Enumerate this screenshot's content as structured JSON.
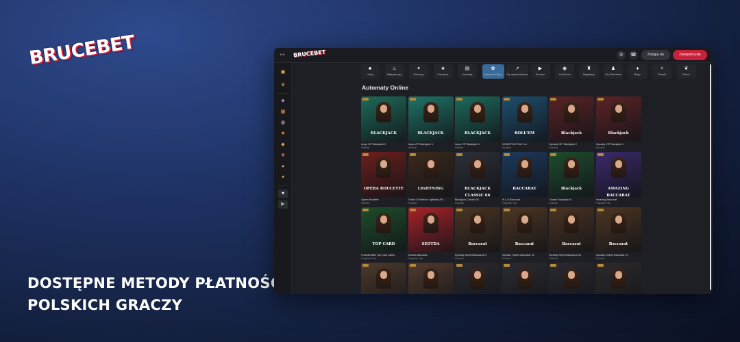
{
  "brand": {
    "logo_text": "BRUCEBET",
    "accent_red": "#c8213b",
    "accent_blue": "#1b2a6b"
  },
  "headline": {
    "line1": "DOSTĘPNE METODY PŁATNOŚCI DLA",
    "line2": "POLSKICH GRACZY"
  },
  "app": {
    "topbar": {
      "collapse_icon": "↦",
      "mini_logo": "BRUCEBET",
      "icons": [
        "settings-icon",
        "support-icon"
      ],
      "login_label": "Zaloguj się",
      "register_label": "Zarejestruj się"
    },
    "sidebar_icons": [
      "gift-icon",
      "trophy-icon",
      "dice-icon",
      "cards-icon",
      "ball-icon",
      "star-icon",
      "chip-icon",
      "game-icon",
      "coin-icon",
      "apple-icon",
      "android-icon"
    ],
    "categories": [
      {
        "icon": "♣",
        "label": "Lobby"
      },
      {
        "icon": "♨",
        "label": "Najlepsze gry"
      },
      {
        "icon": "✦",
        "label": "Nowe gry"
      },
      {
        "icon": "★",
        "label": "Popularne"
      },
      {
        "icon": "▤",
        "label": "Automaty"
      },
      {
        "icon": "✿",
        "label": "Kasyno Na Żywo"
      },
      {
        "icon": "➚",
        "label": "Gry natychmiastowe"
      },
      {
        "icon": "▶",
        "label": "Na żywo"
      },
      {
        "icon": "◉",
        "label": "Kup Bonus"
      },
      {
        "icon": "♜",
        "label": "Megaways"
      },
      {
        "icon": "♟",
        "label": "Gry Planszowe"
      },
      {
        "icon": "♦",
        "label": "Bingo"
      },
      {
        "icon": "✧",
        "label": "Zdrapki"
      },
      {
        "icon": "❦",
        "label": "Owoce"
      }
    ],
    "section_title": "Automaty Online",
    "games": [
      {
        "banner": "BLACKJACK",
        "name": "Aqua VIP Blackjack 2",
        "provider": "Winfinity",
        "bg": "#1d6b5a"
      },
      {
        "banner": "BLACKJACK",
        "name": "Aqua VIP Blackjack 3",
        "provider": "Winfinity",
        "bg": "#1f7466"
      },
      {
        "banner": "BLACKJACK",
        "name": "Aqua VIP Blackjack 1",
        "provider": "Winfinity",
        "bg": "#1b6a5c"
      },
      {
        "banner": "ROLL'EM",
        "name": "MONOPOLY Roll 'em",
        "provider": "Evolution",
        "bg": "#1e4f6e"
      },
      {
        "banner": "Blackjack",
        "name": "Dynasty VIP Blackjack 2",
        "provider": "Evolution",
        "bg": "#5a2325"
      },
      {
        "banner": "Blackjack",
        "name": "Dynasty VIP Blackjack 1",
        "provider": "Evolution",
        "bg": "#5c2426"
      },
      {
        "banner": "OPERA ROULETTE",
        "name": "Opera Roulette",
        "provider": "Winfinity",
        "bg": "#6b1f1c"
      },
      {
        "banner": "LIGHTNING",
        "name": "Turbot XXXtreme Lightning Ro...",
        "provider": "Evolution",
        "bg": "#3a2a1c"
      },
      {
        "banner": "BLACKJACK CLASSIC 66",
        "name": "Blackjack Classic 66",
        "provider": "Evolution",
        "bg": "#2c3038"
      },
      {
        "banner": "BACCARAT",
        "name": "HI-LO Baccarat",
        "provider": "Pragmatic Play",
        "bg": "#1d3a5c"
      },
      {
        "banner": "Blackjack",
        "name": "Classic Blackjack A",
        "provider": "Evolution",
        "bg": "#1d4d2e"
      },
      {
        "banner": "AMAZING BACCARAT",
        "name": "Amazing Baccarat",
        "provider": "Pragmatic Play",
        "bg": "#3b2a6b"
      },
      {
        "banner": "TOP CARD",
        "name": "Football Blitz Top Card Latino",
        "provider": "Pragmatic Play",
        "bg": "#1d4d2a"
      },
      {
        "banner": "SEOTDA",
        "name": "Seotda Baccarat",
        "provider": "Pragmatic Play",
        "bg": "#a8232a"
      },
      {
        "banner": "Baccarat",
        "name": "Dynasty Speed Baccarat 17",
        "provider": "Evolution",
        "bg": "#4a3522"
      },
      {
        "banner": "Baccarat",
        "name": "Dynasty Speed Baccarat 16",
        "provider": "Evolution",
        "bg": "#4d3723"
      },
      {
        "banner": "Baccarat",
        "name": "Dynasty Speed Baccarat 15",
        "provider": "Evolution",
        "bg": "#4a3421"
      },
      {
        "banner": "Baccarat",
        "name": "Dynasty Speed Baccarat 14",
        "provider": "Evolution",
        "bg": "#4c3622"
      },
      {
        "banner": "",
        "name": "",
        "provider": "",
        "bg": "#4d3a2c"
      },
      {
        "banner": "",
        "name": "",
        "provider": "",
        "bg": "#503b2d"
      },
      {
        "banner": "",
        "name": "",
        "provider": "",
        "bg": "#2a2a30"
      },
      {
        "banner": "",
        "name": "",
        "provider": "",
        "bg": "#2b2b31"
      },
      {
        "banner": "",
        "name": "",
        "provider": "",
        "bg": "#29292f"
      },
      {
        "banner": "",
        "name": "",
        "provider": "",
        "bg": "#2d2a2a"
      }
    ]
  }
}
